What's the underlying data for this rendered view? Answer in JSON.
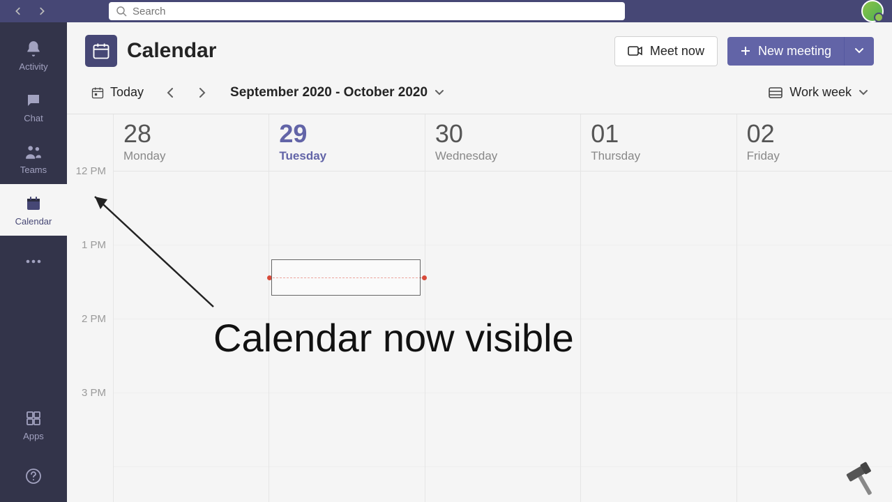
{
  "topbar": {
    "search_placeholder": "Search"
  },
  "sidebar": {
    "items": [
      {
        "label": "Activity"
      },
      {
        "label": "Chat"
      },
      {
        "label": "Teams"
      },
      {
        "label": "Calendar"
      },
      {
        "label": ""
      }
    ],
    "bottom": [
      {
        "label": "Apps"
      },
      {
        "label": "Help"
      }
    ],
    "active_index": 3
  },
  "header": {
    "title": "Calendar",
    "meet_now": "Meet now",
    "new_meeting": "New meeting"
  },
  "toolbar": {
    "today": "Today",
    "date_range": "September 2020 - October 2020",
    "view": "Work week"
  },
  "days": [
    {
      "num": "28",
      "name": "Monday",
      "is_today": false
    },
    {
      "num": "29",
      "name": "Tuesday",
      "is_today": true
    },
    {
      "num": "30",
      "name": "Wednesday",
      "is_today": false
    },
    {
      "num": "01",
      "name": "Thursday",
      "is_today": false
    },
    {
      "num": "02",
      "name": "Friday",
      "is_today": false
    }
  ],
  "time_labels": [
    "12 PM",
    "1 PM",
    "2 PM",
    "3 PM"
  ],
  "annotation": {
    "text": "Calendar now visible"
  }
}
